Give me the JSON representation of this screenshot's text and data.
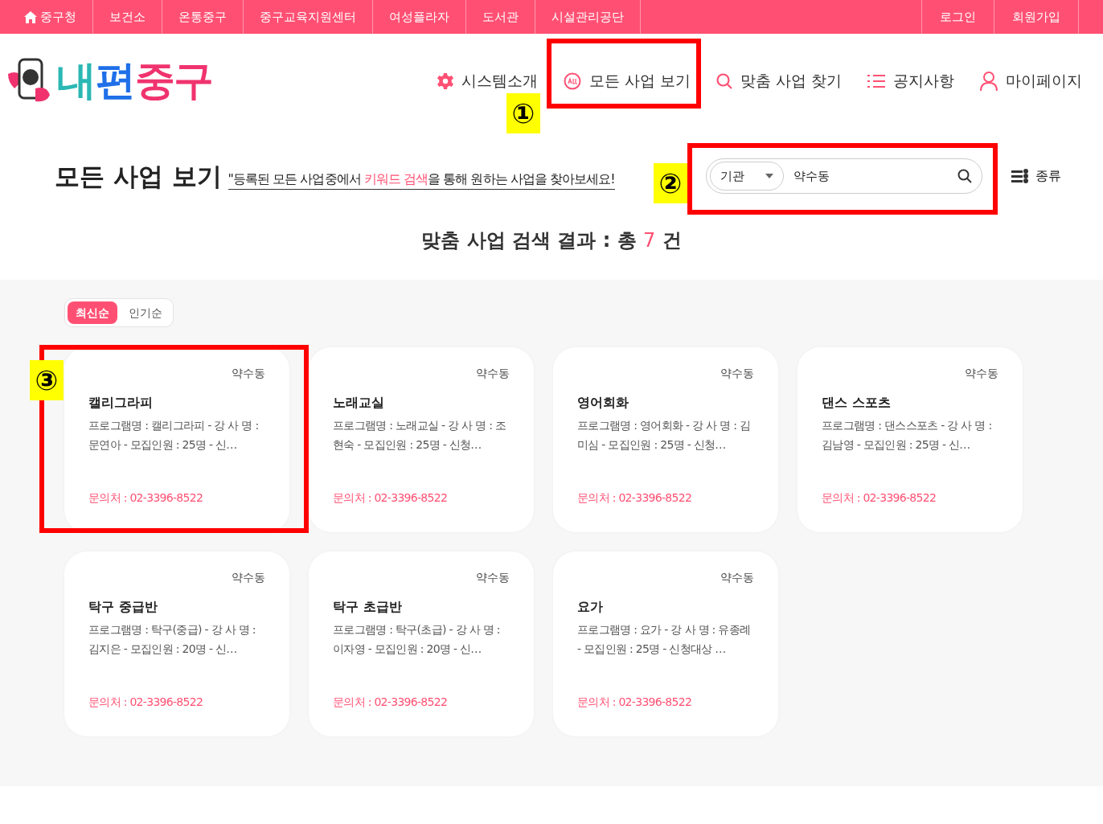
{
  "top_bar": {
    "left_links": [
      {
        "label": "중구청",
        "kind": "home"
      },
      {
        "label": "보건소",
        "kind": "link"
      },
      {
        "label": "온통중구",
        "kind": "link"
      },
      {
        "label": "중구교육지원센터",
        "kind": "link"
      },
      {
        "label": "여성플라자",
        "kind": "link"
      },
      {
        "label": "도서관",
        "kind": "link"
      },
      {
        "label": "시설관리공단",
        "kind": "link"
      }
    ],
    "right_links": [
      "로그인",
      "회원가입"
    ]
  },
  "logo": {
    "parts": [
      {
        "text": "내",
        "color": "#2bb8b4"
      },
      {
        "text": "편",
        "color": "#1f6fe8"
      },
      {
        "text": "중구",
        "color": "#f0336e"
      }
    ]
  },
  "nav": [
    {
      "label": "시스템소개",
      "kind": "gear"
    },
    {
      "label": "모든 사업 보기",
      "kind": "all"
    },
    {
      "label": "맞춤 사업 찾기",
      "kind": "search"
    },
    {
      "label": "공지사항",
      "kind": "list"
    },
    {
      "label": "마이페이지",
      "kind": "person"
    }
  ],
  "page_title": "모든 사업 보기",
  "subtitle": [
    {
      "text": "\"등록된 모든 사업중에서 ",
      "highlight": false
    },
    {
      "text": "키워드 검색",
      "highlight": true
    },
    {
      "text": "을 통해 원하는 사업을 찾아보세요!",
      "highlight": false
    }
  ],
  "search": {
    "category": "기관",
    "value": "약수동"
  },
  "filter_button": "종류",
  "result": {
    "label": "맞춤 사업 검색 결과 : 총",
    "count": "7",
    "unit": "건"
  },
  "sort_tabs": [
    {
      "label": "최신순",
      "selected": true
    },
    {
      "label": "인기순",
      "selected": false
    }
  ],
  "cards": [
    {
      "area": "약수동",
      "title": "캘리그라피",
      "description": "프로그램명 : 캘리그라피 - 강 사 명 : 문연아 - 모집인원 : 25명 - 신…",
      "contact": "문의처 : 02-3396-8522"
    },
    {
      "area": "약수동",
      "title": "노래교실",
      "description": "프로그램명 : 노래교실 - 강 사 명 : 조현숙 - 모집인원 : 25명 - 신청…",
      "contact": "문의처 : 02-3396-8522"
    },
    {
      "area": "약수동",
      "title": "영어회화",
      "description": "프로그램명 : 영어회화 - 강 사 명 : 김미심 - 모집인원 : 25명 - 신청…",
      "contact": "문의처 : 02-3396-8522"
    },
    {
      "area": "약수동",
      "title": "댄스 스포츠",
      "description": "프로그램명 : 댄스스포츠 - 강 사 명 : 김남영 - 모집인원 : 25명 - 신…",
      "contact": "문의처 : 02-3396-8522"
    },
    {
      "area": "약수동",
      "title": "탁구 중급반",
      "description": "프로그램명 : 탁구(중급) - 강 사 명 : 김지은 - 모집인원 : 20명 - 신…",
      "contact": "문의처 : 02-3396-8522"
    },
    {
      "area": "약수동",
      "title": "탁구 초급반",
      "description": "프로그램명 : 탁구(초급) - 강 사 명 : 이자영 - 모집인원 : 20명 - 신…",
      "contact": "문의처 : 02-3396-8522"
    },
    {
      "area": "약수동",
      "title": "요가",
      "description": "프로그램명 : 요가 - 강 사 명 : 유종례 - 모집인원 : 25명 - 신청대상 …",
      "contact": "문의처 : 02-3396-8522"
    }
  ],
  "annotations": [
    {
      "number": "①"
    },
    {
      "number": "②"
    },
    {
      "number": "③"
    }
  ]
}
